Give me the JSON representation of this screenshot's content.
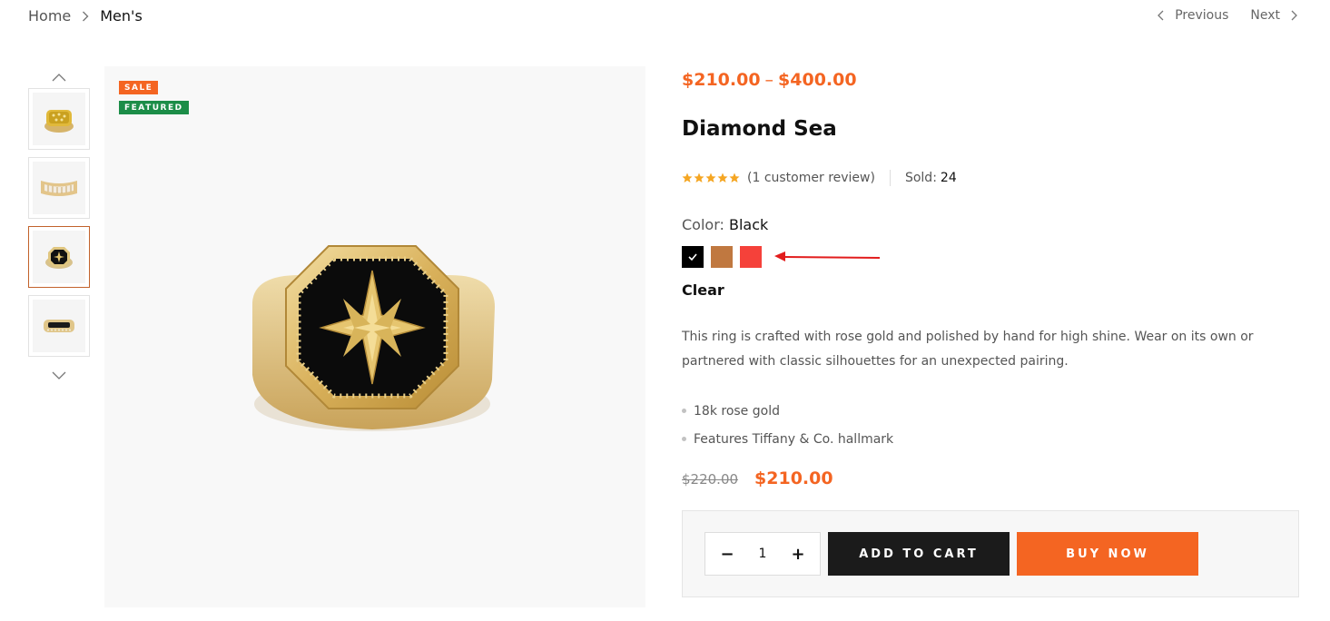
{
  "breadcrumb": {
    "home": "Home",
    "current": "Men's"
  },
  "pager": {
    "previous": "Previous",
    "next": "Next"
  },
  "badges": {
    "sale": "SALE",
    "featured": "FEATURED"
  },
  "product": {
    "price_low": "$210.00",
    "price_sep": "–",
    "price_high": "$400.00",
    "title": "Diamond Sea",
    "rating_stars": 5,
    "review_text": "(1 customer review)",
    "sold_label": "Sold:",
    "sold_value": "24",
    "color_label": "Color:",
    "color_value": "Black",
    "swatches": [
      {
        "name": "Black",
        "color": "#000000",
        "selected": true
      },
      {
        "name": "Brown",
        "color": "#c07840",
        "selected": false
      },
      {
        "name": "Red",
        "color": "#f5413a",
        "selected": false
      }
    ],
    "clear_label": "Clear",
    "description": "This ring is crafted with rose gold and polished by hand for high shine. Wear on its own or partnered with classic silhouettes for an unexpected pairing.",
    "features": [
      "18k rose gold",
      "Features Tiffany & Co. hallmark"
    ],
    "old_price": "$220.00",
    "new_price": "$210.00"
  },
  "cart": {
    "quantity": "1",
    "minus": "−",
    "plus": "+",
    "add_to_cart": "ADD TO CART",
    "buy_now": "BUY NOW"
  },
  "colors": {
    "accent": "#f46522",
    "featured": "#1c8d48",
    "dark_button": "#1b1b1b"
  }
}
